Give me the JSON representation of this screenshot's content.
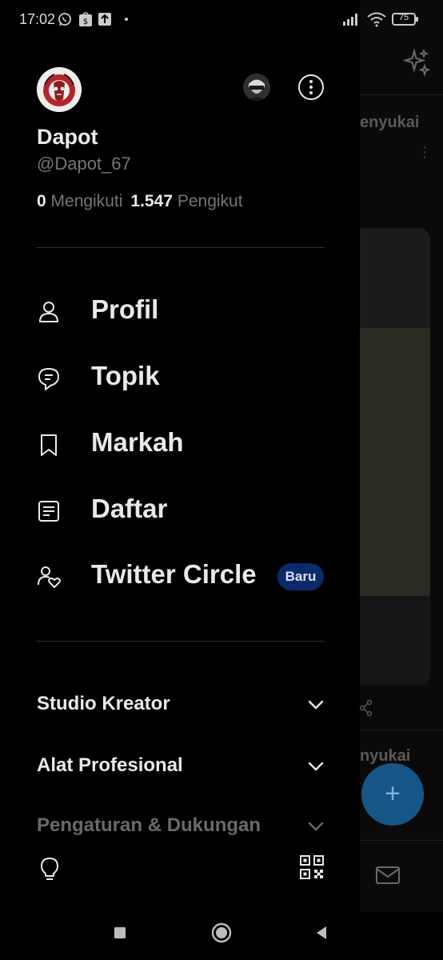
{
  "status_bar": {
    "time": "17:02",
    "battery": "75"
  },
  "drawer": {
    "display_name": "Dapot",
    "handle": "@Dapot_67",
    "following_count": "0",
    "following_label": "Mengikuti",
    "followers_count": "1.547",
    "followers_label": "Pengikut",
    "nav": [
      {
        "label": "Profil",
        "icon": "person-icon"
      },
      {
        "label": "Topik",
        "icon": "topics-icon"
      },
      {
        "label": "Markah",
        "icon": "bookmark-icon"
      },
      {
        "label": "Daftar",
        "icon": "list-icon"
      },
      {
        "label": "Twitter Circle",
        "icon": "circle-people-icon",
        "badge": "Baru"
      }
    ],
    "sections": [
      {
        "label": "Studio Kreator"
      },
      {
        "label": "Alat Profesional"
      },
      {
        "label": "Pengaturan & Dukungan"
      }
    ]
  },
  "background": {
    "snippet_1": "enyukai",
    "snippet_2": "nyukai"
  },
  "colors": {
    "accent": "#1d9bf0",
    "badge_bg": "#0a2a6b",
    "text_primary": "#e7e9ea",
    "text_secondary": "#71767b"
  }
}
